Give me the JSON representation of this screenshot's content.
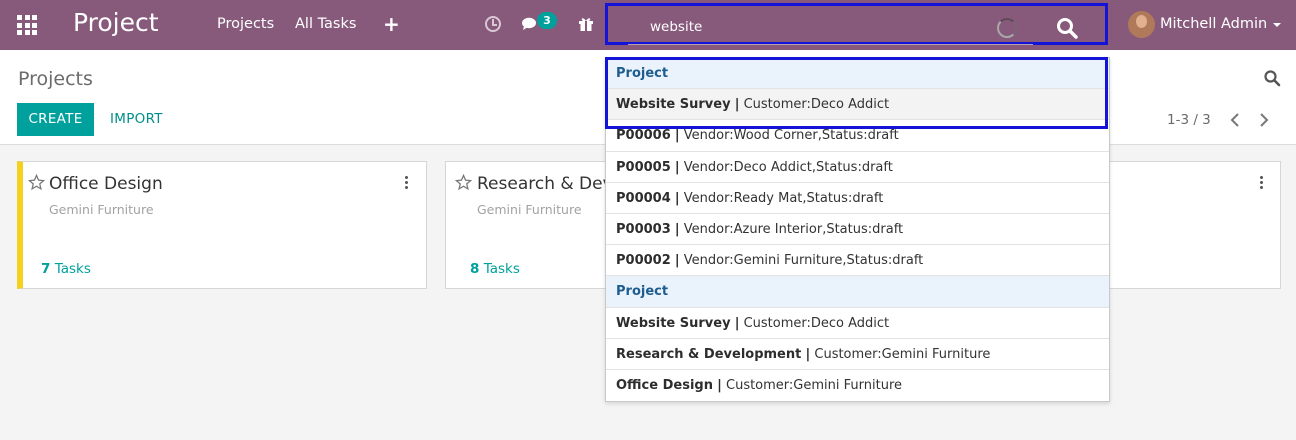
{
  "app": {
    "title": "Project",
    "nav": [
      "Projects",
      "All Tasks"
    ],
    "nav_add_icon": "plus-icon",
    "chat_count": "3",
    "user": "Mitchell Admin"
  },
  "search": {
    "value": "website",
    "placeholder": ""
  },
  "control_panel": {
    "breadcrumb": "Projects",
    "create_label": "CREATE",
    "import_label": "IMPORT",
    "pager": "1-3 / 3"
  },
  "cards": [
    {
      "title": "Office Design",
      "subtitle": "Gemini Furniture",
      "task_count": "7",
      "task_label": "Tasks",
      "color": "#f4d11c"
    },
    {
      "title": "Research & Development",
      "subtitle": "Gemini Furniture",
      "task_count": "8",
      "task_label": "Tasks"
    }
  ],
  "dropdown": [
    {
      "type": "header",
      "label": "Project"
    },
    {
      "type": "item",
      "name": "Website Survey",
      "detail": "Customer:Deco Addict"
    },
    {
      "type": "item",
      "name": "P00006",
      "detail": "Vendor:Wood Corner,Status:draft"
    },
    {
      "type": "item",
      "name": "P00005",
      "detail": "Vendor:Deco Addict,Status:draft"
    },
    {
      "type": "item",
      "name": "P00004",
      "detail": "Vendor:Ready Mat,Status:draft"
    },
    {
      "type": "item",
      "name": "P00003",
      "detail": "Vendor:Azure Interior,Status:draft"
    },
    {
      "type": "item",
      "name": "P00002",
      "detail": "Vendor:Gemini Furniture,Status:draft"
    },
    {
      "type": "header",
      "label": "Project"
    },
    {
      "type": "item",
      "name": "Website Survey",
      "detail": "Customer:Deco Addict"
    },
    {
      "type": "item",
      "name": "Research & Development",
      "detail": "Customer:Gemini Furniture"
    },
    {
      "type": "item",
      "name": "Office Design",
      "detail": "Customer:Gemini Furniture"
    }
  ],
  "colors": {
    "navbar": "#875a7b",
    "accent": "#00a09d",
    "highlight_border": "#1414d8",
    "header_row": "#eaf2fb"
  }
}
